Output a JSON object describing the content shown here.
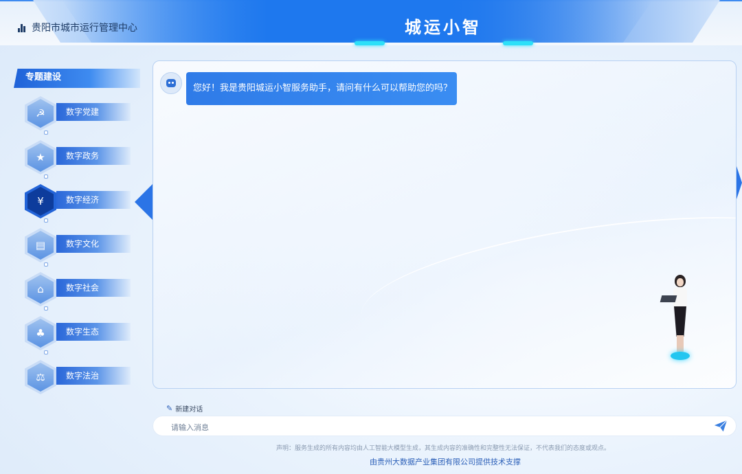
{
  "header": {
    "brand": "贵阳市城市运行管理中心",
    "title": "城运小智"
  },
  "sidebar": {
    "section_title": "专题建设",
    "items": [
      {
        "label": "数字党建",
        "icon": "party-emblem-icon",
        "active": false
      },
      {
        "label": "数字政务",
        "icon": "government-badge-icon",
        "active": false
      },
      {
        "label": "数字经济",
        "icon": "yen-wallet-icon",
        "active": true
      },
      {
        "label": "数字文化",
        "icon": "book-icon",
        "active": false
      },
      {
        "label": "数字社会",
        "icon": "community-house-icon",
        "active": false
      },
      {
        "label": "数字生态",
        "icon": "ecology-hand-icon",
        "active": false
      },
      {
        "label": "数字法治",
        "icon": "law-scale-icon",
        "active": false
      }
    ]
  },
  "chat": {
    "messages": [
      {
        "role": "assistant",
        "text": "您好！我是贵阳城运小智服务助手，请问有什么可以帮助您的吗？"
      }
    ]
  },
  "composer": {
    "new_chat_label": "新建对话",
    "placeholder": "请输入消息"
  },
  "footer": {
    "disclaimer": "声明：服务生成的所有内容均由人工智能大模型生成，其生成内容的准确性和完整性无法保证，不代表我们的态度或观点。",
    "support": "由贵州大数据产业集团有限公司提供技术支撑"
  },
  "colors": {
    "accent": "#2b74e6",
    "active_nav": "#0d3c9c",
    "glow": "#2de0f8"
  }
}
